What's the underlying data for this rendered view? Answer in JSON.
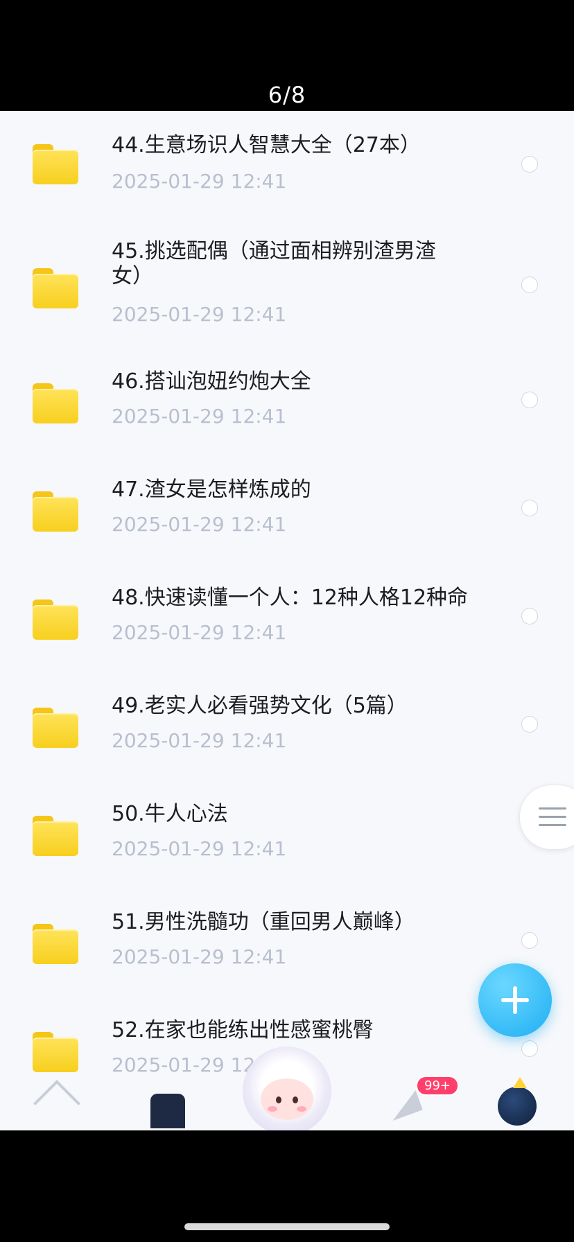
{
  "header": {
    "page_indicator": "6/8"
  },
  "files": [
    {
      "title": "44.生意场识人智慧大全（27本）",
      "date": "2025-01-29  12:41"
    },
    {
      "title": "45.挑选配偶（通过面相辨别渣男渣女）",
      "date": "2025-01-29  12:41"
    },
    {
      "title": "46.搭讪泡妞约炮大全",
      "date": "2025-01-29  12:41"
    },
    {
      "title": "47.渣女是怎样炼成的",
      "date": "2025-01-29  12:41"
    },
    {
      "title": "48.快速读懂一个人：12种人格12种命",
      "date": "2025-01-29  12:41"
    },
    {
      "title": "49.老实人必看强势文化（5篇）",
      "date": "2025-01-29  12:41"
    },
    {
      "title": "50.牛人心法",
      "date": "2025-01-29  12:41"
    },
    {
      "title": "51.男性洗髓功（重回男人巅峰）",
      "date": "2025-01-29  12:41"
    },
    {
      "title": "52.在家也能练出性感蜜桃臀",
      "date": "2025-01-29  12:41"
    }
  ],
  "icons": {
    "folder": "folder-icon",
    "select": "radio-circle",
    "side_menu": "menu-icon",
    "add": "plus-icon"
  },
  "tab_bar": {
    "badge": "99+",
    "tabs": [
      "home-icon",
      "files-icon",
      "mascot-icon",
      "send-icon",
      "profile-icon"
    ]
  },
  "colors": {
    "folder": "#f7cf1e",
    "fab": "#1faef2",
    "badge": "#ff3f6b",
    "date_text": "#b8bfcf"
  }
}
